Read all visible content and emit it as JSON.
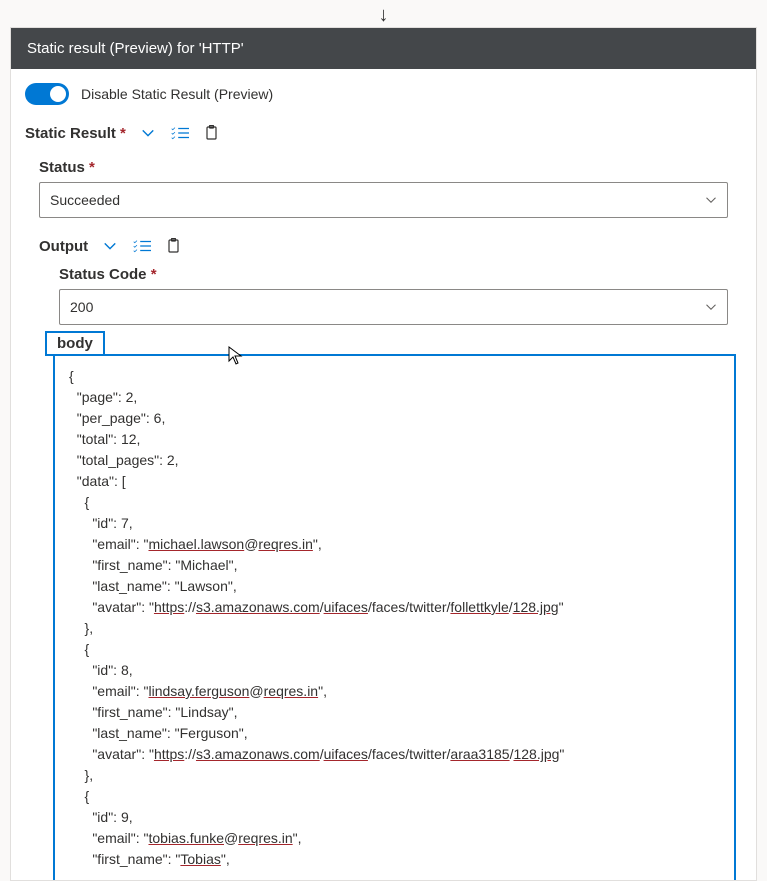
{
  "topArrow": "↓",
  "header": {
    "title": "Static result (Preview) for 'HTTP'"
  },
  "toggle": {
    "label": "Disable Static Result (Preview)"
  },
  "sections": {
    "staticResult": {
      "label": "Static Result",
      "required": "*"
    },
    "status": {
      "label": "Status",
      "required": "*",
      "value": "Succeeded"
    },
    "output": {
      "label": "Output"
    },
    "statusCode": {
      "label": "Status Code",
      "required": "*",
      "value": "200"
    },
    "body": {
      "label": "body",
      "content": {
        "page": 2,
        "per_page": 6,
        "total": 12,
        "total_pages": 2,
        "data": [
          {
            "id": 7,
            "email": "michael.lawson@reqres.in",
            "first_name": "Michael",
            "last_name": "Lawson",
            "avatar": "https://s3.amazonaws.com/uifaces/faces/twitter/follettkyle/128.jpg"
          },
          {
            "id": 8,
            "email": "lindsay.ferguson@reqres.in",
            "first_name": "Lindsay",
            "last_name": "Ferguson",
            "avatar": "https://s3.amazonaws.com/uifaces/faces/twitter/araa3185/128.jpg"
          },
          {
            "id": 9,
            "email": "tobias.funke@reqres.in",
            "first_name": "Tobias"
          }
        ]
      }
    }
  },
  "colors": {
    "accent": "#0078d4",
    "danger": "#a4262c",
    "headerBg": "#44474a"
  }
}
